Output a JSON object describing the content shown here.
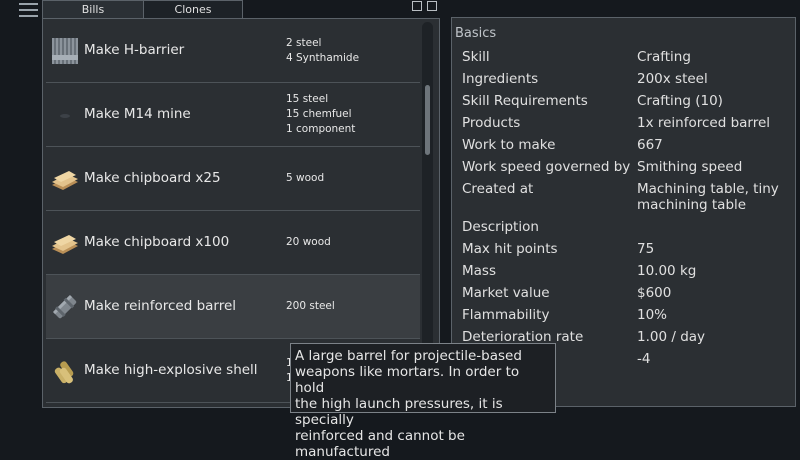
{
  "tabs": [
    {
      "label": "Bills",
      "active": true
    },
    {
      "label": "Clones",
      "active": false
    }
  ],
  "bills": [
    {
      "label": "Make H-barrier",
      "ingredients": [
        "2 steel",
        "4 Synthamide"
      ],
      "icon": "h-barrier-icon",
      "selected": false
    },
    {
      "label": "Make M14 mine",
      "ingredients": [
        "15 steel",
        "15 chemfuel",
        "1 component"
      ],
      "icon": "mine-icon",
      "selected": false
    },
    {
      "label": "Make chipboard x25",
      "ingredients": [
        "5 wood"
      ],
      "icon": "chipboard-icon",
      "selected": false
    },
    {
      "label": "Make chipboard x100",
      "ingredients": [
        "20 wood"
      ],
      "icon": "chipboard-icon",
      "selected": false
    },
    {
      "label": "Make reinforced barrel",
      "ingredients": [
        "200 steel"
      ],
      "icon": "reinforced-barrel-icon",
      "selected": true
    },
    {
      "label": "Make high-explosive shell",
      "ingredients": [
        "1",
        "1"
      ],
      "icon": "shell-icon",
      "selected": false
    }
  ],
  "info": {
    "heading": "Basics",
    "rows": [
      {
        "label": "Skill",
        "value": "Crafting"
      },
      {
        "label": "Ingredients",
        "value": "200x steel"
      },
      {
        "label": "Skill Requirements",
        "value": "Crafting (10)"
      },
      {
        "label": "Products",
        "value": "1x reinforced barrel"
      },
      {
        "label": "Work to make",
        "value": "667"
      },
      {
        "label": "Work speed governed by",
        "value": "Smithing speed"
      },
      {
        "label": "Created at",
        "value": "Machining table, tiny machining table"
      },
      {
        "label": "Description",
        "value": ""
      },
      {
        "label": "Max hit points",
        "value": "75"
      },
      {
        "label": "Mass",
        "value": "10.00 kg"
      },
      {
        "label": "Market value",
        "value": "$600"
      },
      {
        "label": "Flammability",
        "value": "10%"
      },
      {
        "label": "Deterioration rate",
        "value": "1.00 / day"
      },
      {
        "label": "",
        "value": "-4"
      }
    ]
  },
  "tooltip": {
    "lines": [
      "A large barrel for projectile-based",
      "weapons like mortars. In order to hold",
      "the high launch pressures, it is specially",
      "reinforced and cannot be manufactured"
    ]
  },
  "colors": {
    "background": "#15191e",
    "panel": "#2b2f33",
    "selected_row": "#3a3e42",
    "border": "#5b6269"
  }
}
